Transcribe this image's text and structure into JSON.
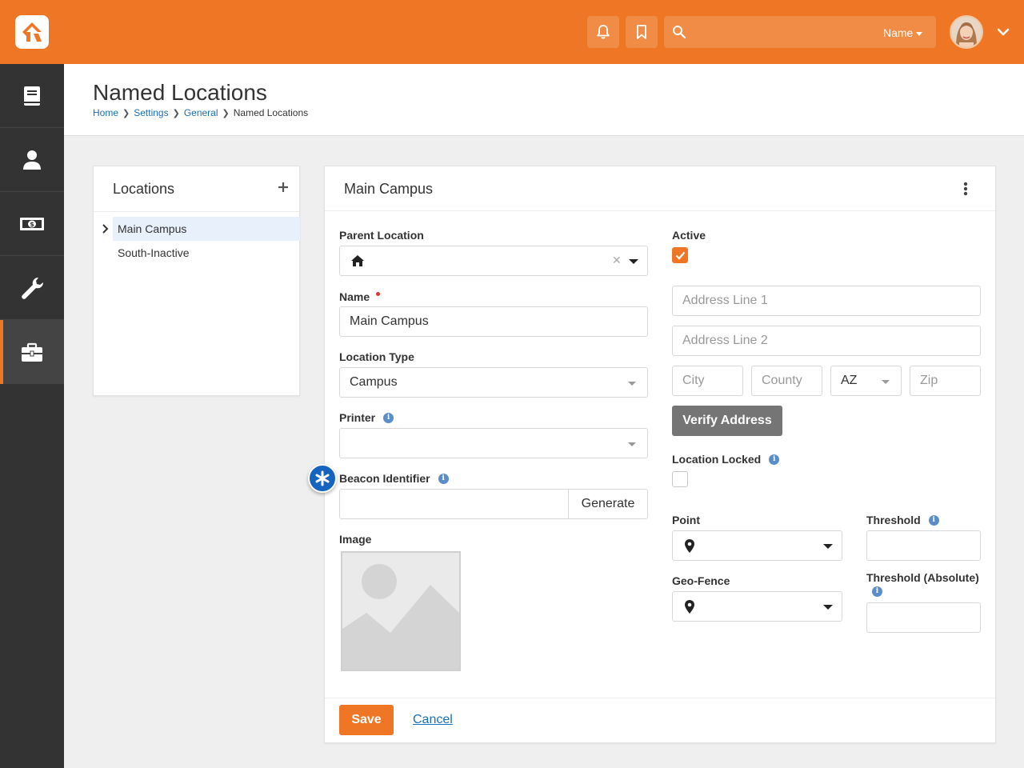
{
  "header": {
    "search_placeholder": "",
    "search_scope": "Name"
  },
  "page": {
    "title": "Named Locations",
    "breadcrumb": [
      "Home",
      "Settings",
      "General",
      "Named Locations"
    ]
  },
  "locations_panel": {
    "title": "Locations",
    "items": [
      {
        "label": "Main Campus",
        "selected": true,
        "has_children": true
      },
      {
        "label": "South-Inactive",
        "selected": false,
        "has_children": false
      }
    ]
  },
  "detail": {
    "title": "Main Campus",
    "parent_location": {
      "label": "Parent Location",
      "value": ""
    },
    "name": {
      "label": "Name",
      "value": "Main Campus"
    },
    "location_type": {
      "label": "Location Type",
      "value": "Campus"
    },
    "printer": {
      "label": "Printer",
      "value": ""
    },
    "beacon": {
      "label": "Beacon Identifier",
      "value": "",
      "generate_label": "Generate"
    },
    "image": {
      "label": "Image"
    },
    "active": {
      "label": "Active",
      "checked": true
    },
    "address": {
      "line1_placeholder": "Address Line 1",
      "line2_placeholder": "Address Line 2",
      "city_placeholder": "City",
      "county_placeholder": "County",
      "state_value": "AZ",
      "zip_placeholder": "Zip",
      "verify_label": "Verify Address"
    },
    "location_locked": {
      "label": "Location Locked",
      "checked": false
    },
    "point": {
      "label": "Point"
    },
    "threshold": {
      "label": "Threshold",
      "value": ""
    },
    "geo_fence": {
      "label": "Geo-Fence"
    },
    "threshold_absolute": {
      "label": "Threshold (Absolute)",
      "value": ""
    },
    "save_label": "Save",
    "cancel_label": "Cancel"
  },
  "colors": {
    "brand": "#ee7625",
    "sidebar": "#333333",
    "link": "#1a6fb5",
    "info": "#5b8dc9",
    "beacon": "#1565c0"
  }
}
